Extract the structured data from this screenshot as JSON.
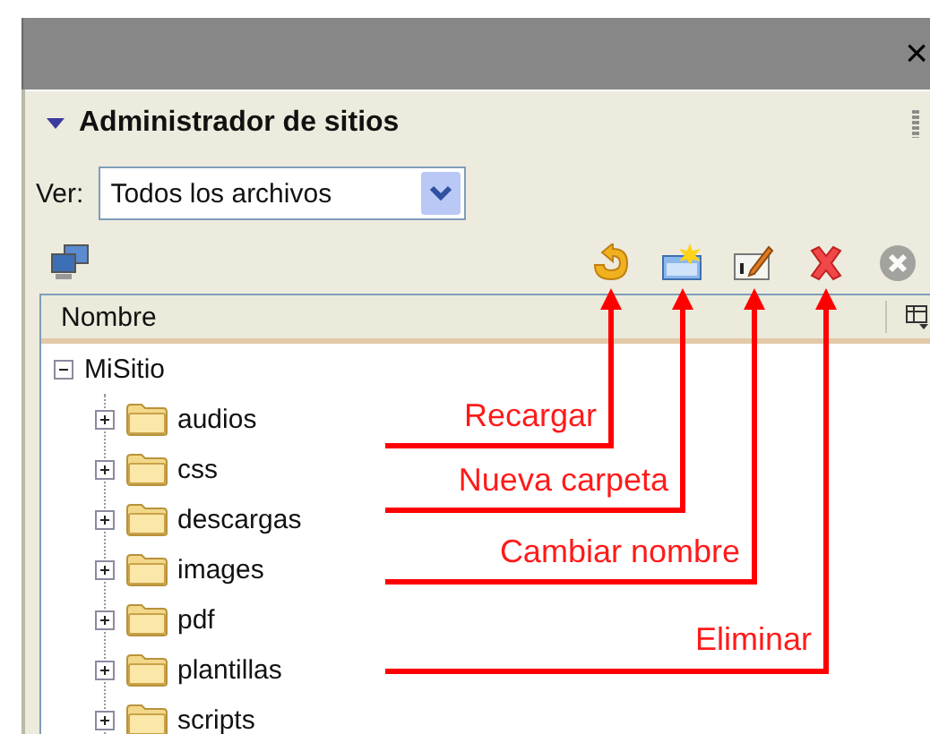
{
  "window": {
    "close": "×"
  },
  "panel": {
    "title": "Administrador de sitios",
    "expanded": true
  },
  "view": {
    "label": "Ver:",
    "value": "Todos los archivos"
  },
  "toolbar": {
    "actions": [
      {
        "kind": "connect",
        "disabled": false
      },
      {
        "kind": "refresh",
        "disabled": false,
        "callout": "Recargar"
      },
      {
        "kind": "new-folder",
        "disabled": false,
        "callout": "Nueva carpeta"
      },
      {
        "kind": "rename",
        "disabled": false,
        "callout": "Cambiar nombre"
      },
      {
        "kind": "delete",
        "disabled": false,
        "callout": "Eliminar"
      },
      {
        "kind": "stop",
        "disabled": true
      }
    ]
  },
  "tree": {
    "column": "Nombre",
    "items": [
      {
        "label": "MiSitio",
        "kind": "site",
        "expanded": true,
        "children": [
          {
            "label": "audios",
            "kind": "folder",
            "expanded": false
          },
          {
            "label": "css",
            "kind": "folder",
            "expanded": false
          },
          {
            "label": "descargas",
            "kind": "folder",
            "expanded": false
          },
          {
            "label": "images",
            "kind": "folder",
            "expanded": false
          },
          {
            "label": "pdf",
            "kind": "folder",
            "expanded": false
          },
          {
            "label": "plantillas",
            "kind": "folder",
            "expanded": false
          },
          {
            "label": "scripts",
            "kind": "folder",
            "expanded": false
          }
        ]
      }
    ]
  }
}
